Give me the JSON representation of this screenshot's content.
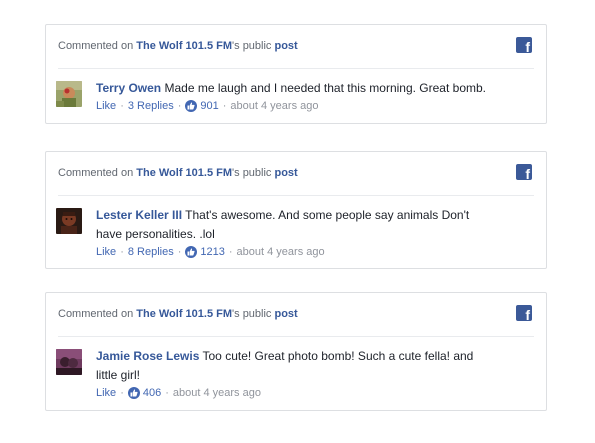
{
  "cards": [
    {
      "header": {
        "prefix": "Commented on ",
        "page_name": "The Wolf 101.5 FM",
        "middle": "'s public ",
        "post_label": "post"
      },
      "comment": {
        "author": "Terry Owen",
        "text": " Made me laugh and I needed that this morning. Great bomb.",
        "like_label": "Like",
        "replies_label": "3 Replies",
        "like_count": "901",
        "time": "about 4 years ago"
      }
    },
    {
      "header": {
        "prefix": "Commented on ",
        "page_name": "The Wolf 101.5 FM",
        "middle": "'s public ",
        "post_label": "post"
      },
      "comment": {
        "author": "Lester Keller III",
        "text": " That's awesome. And some people say animals Don't have personalities. .lol",
        "like_label": "Like",
        "replies_label": "8 Replies",
        "like_count": "1213",
        "time": "about 4 years ago"
      }
    },
    {
      "header": {
        "prefix": "Commented on ",
        "page_name": "The Wolf 101.5 FM",
        "middle": "'s public ",
        "post_label": "post"
      },
      "comment": {
        "author": "Jamie Rose Lewis",
        "text": " Too cute! Great photo bomb! Such a cute fella! and little girl!",
        "like_label": "Like",
        "replies_label": "",
        "like_count": "406",
        "time": "about 4 years ago"
      }
    }
  ],
  "separator": "·",
  "brand_color": "#3b5998",
  "link_color": "#365899",
  "icons": {
    "facebook": "facebook-icon",
    "like": "thumbs-up-icon"
  }
}
